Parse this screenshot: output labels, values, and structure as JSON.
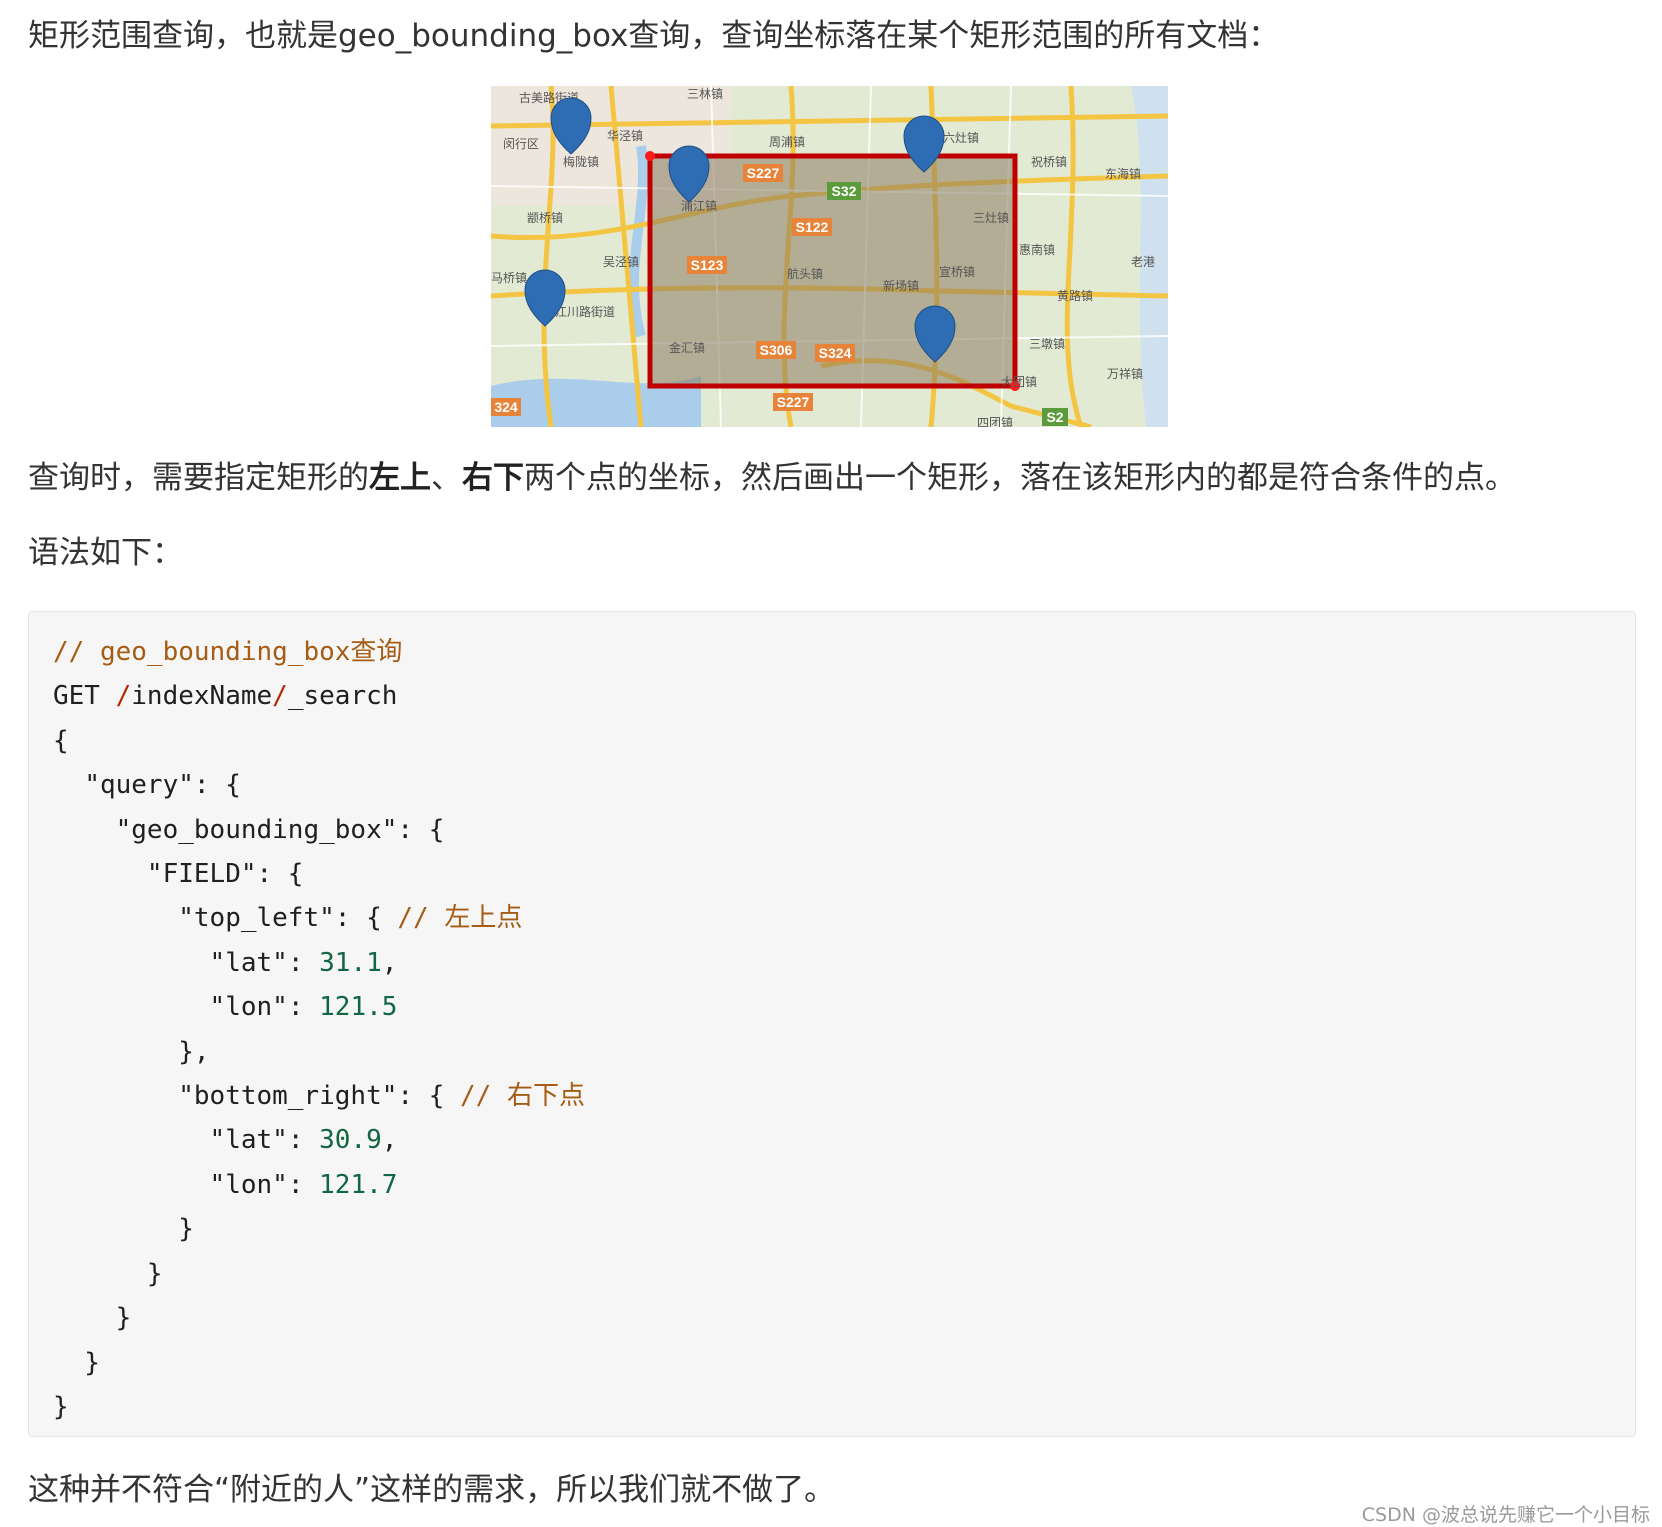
{
  "paragraphs": {
    "p1": "矩形范围查询，也就是geo_bounding_box查询，查询坐标落在某个矩形范围的所有文档：",
    "p2_a": "查询时，需要指定矩形的",
    "p2_b1": "左上",
    "p2_sep": "、",
    "p2_b2": "右下",
    "p2_c": "两个点的坐标，然后画出一个矩形，落在该矩形内的都是符合条件的点。",
    "p3": "语法如下：",
    "p4": "这种并不符合“附近的人”这样的需求，所以我们就不做了。"
  },
  "map": {
    "place_labels": [
      "古美路街道",
      "三林镇",
      "闵行区",
      "华泾镇",
      "梅陇镇",
      "周浦镇",
      "六灶镇",
      "祝桥镇",
      "东海镇",
      "颛桥镇",
      "浦江镇",
      "三灶镇",
      "吴泾镇",
      "惠南镇",
      "老港",
      "马桥镇",
      "航头镇",
      "新场镇",
      "宣桥镇",
      "黄路镇",
      "江川路街道",
      "金汇镇",
      "三墩镇",
      "万祥镇",
      "大团镇",
      "四团镇"
    ],
    "road_labels": [
      "S227",
      "S32",
      "S122",
      "S123",
      "S306",
      "S324",
      "S227",
      "324",
      "S2"
    ],
    "colors": {
      "rect": "#c00000",
      "pin": "#2e6db4",
      "road": "#f4c542",
      "water": "#a9cdea"
    }
  },
  "code": {
    "comment_title": "// geo_bounding_box查询",
    "get": "GET",
    "path_index": "indexName",
    "path_search": "_search",
    "query_key": "\"query\"",
    "gbb_key": "\"geo_bounding_box\"",
    "field_key": "\"FIELD\"",
    "top_left_key": "\"top_left\"",
    "top_left_comment": "// 左上点",
    "lat_key": "\"lat\"",
    "lon_key": "\"lon\"",
    "top_left_lat": "31.1",
    "top_left_lon": "121.5",
    "bottom_right_key": "\"bottom_right\"",
    "bottom_right_comment": "// 右下点",
    "bottom_right_lat": "30.9",
    "bottom_right_lon": "121.7"
  },
  "watermark": "CSDN @波总说先赚它一个小目标"
}
